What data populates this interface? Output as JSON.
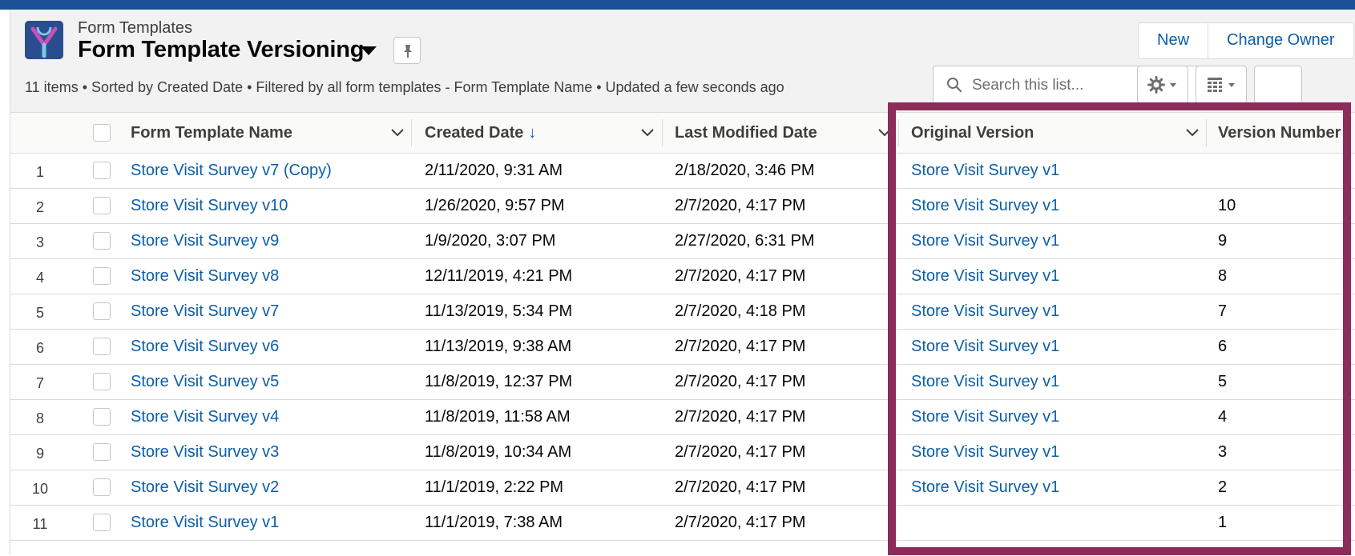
{
  "colors": {
    "accent": "#0b5ea8",
    "highlight_border": "#8b2c5a",
    "top_band": "#1b5297"
  },
  "header": {
    "object_label": "Form Templates",
    "view_title": "Form Template Versioning",
    "status_line": "11 items • Sorted by Created Date • Filtered by all form templates - Form Template Name • Updated a few seconds ago",
    "icons": {
      "app": "form-template-app-icon",
      "pin": "pin-icon",
      "view_menu": "caret-down-icon"
    }
  },
  "actions": {
    "new_label": "New",
    "change_owner_label": "Change Owner"
  },
  "toolbar": {
    "search_placeholder": "Search this list...",
    "icons": [
      "search-icon",
      "gear-icon",
      "table-icon"
    ]
  },
  "table": {
    "columns": {
      "name": "Form Template Name",
      "created": "Created Date",
      "modified": "Last Modified Date",
      "original": "Original Version",
      "version": "Version Number"
    },
    "sort_indicator": "↓",
    "rows": [
      {
        "num": "1",
        "name": "Store Visit Survey v7 (Copy)",
        "created": "2/11/2020, 9:31 AM",
        "modified": "2/18/2020, 3:46 PM",
        "original": "Store Visit Survey v1",
        "version": ""
      },
      {
        "num": "2",
        "name": "Store Visit Survey v10",
        "created": "1/26/2020, 9:57 PM",
        "modified": "2/7/2020, 4:17 PM",
        "original": "Store Visit Survey v1",
        "version": "10"
      },
      {
        "num": "3",
        "name": "Store Visit Survey v9",
        "created": "1/9/2020, 3:07 PM",
        "modified": "2/27/2020, 6:31 PM",
        "original": "Store Visit Survey v1",
        "version": "9"
      },
      {
        "num": "4",
        "name": "Store Visit Survey v8",
        "created": "12/11/2019, 4:21 PM",
        "modified": "2/7/2020, 4:17 PM",
        "original": "Store Visit Survey v1",
        "version": "8"
      },
      {
        "num": "5",
        "name": "Store Visit Survey v7",
        "created": "11/13/2019, 5:34 PM",
        "modified": "2/7/2020, 4:18 PM",
        "original": "Store Visit Survey v1",
        "version": "7"
      },
      {
        "num": "6",
        "name": "Store Visit Survey v6",
        "created": "11/13/2019, 9:38 AM",
        "modified": "2/7/2020, 4:17 PM",
        "original": "Store Visit Survey v1",
        "version": "6"
      },
      {
        "num": "7",
        "name": "Store Visit Survey v5",
        "created": "11/8/2019, 12:37 PM",
        "modified": "2/7/2020, 4:17 PM",
        "original": "Store Visit Survey v1",
        "version": "5"
      },
      {
        "num": "8",
        "name": "Store Visit Survey v4",
        "created": "11/8/2019, 11:58 AM",
        "modified": "2/7/2020, 4:17 PM",
        "original": "Store Visit Survey v1",
        "version": "4"
      },
      {
        "num": "9",
        "name": "Store Visit Survey v3",
        "created": "11/8/2019, 10:34 AM",
        "modified": "2/7/2020, 4:17 PM",
        "original": "Store Visit Survey v1",
        "version": "3"
      },
      {
        "num": "10",
        "name": "Store Visit Survey v2",
        "created": "11/1/2019, 2:22 PM",
        "modified": "2/7/2020, 4:17 PM",
        "original": "Store Visit Survey v1",
        "version": "2"
      },
      {
        "num": "11",
        "name": "Store Visit Survey v1",
        "created": "11/1/2019, 7:38 AM",
        "modified": "2/7/2020, 4:17 PM",
        "original": "",
        "version": "1"
      }
    ]
  }
}
